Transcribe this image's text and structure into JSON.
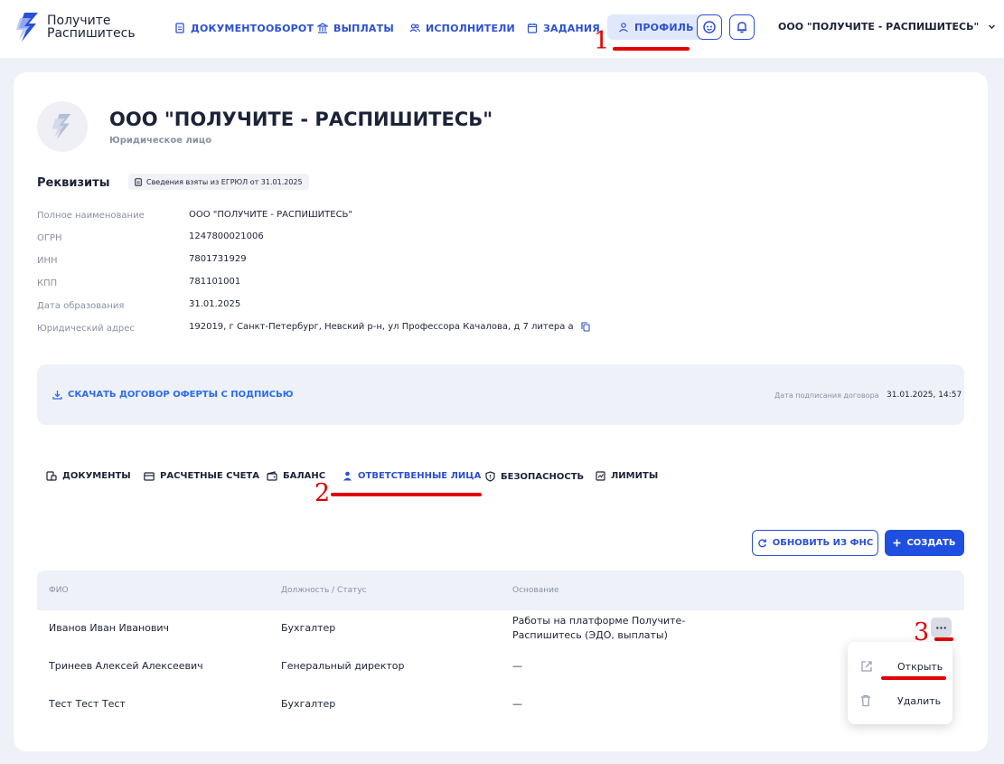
{
  "brand": {
    "line1": "Получите",
    "line2": "Распишитесь"
  },
  "nav": {
    "documents": "ДОКУМЕНТООБОРОТ",
    "payments": "ВЫПЛАТЫ",
    "executors": "ИСПОЛНИТЕЛИ",
    "tasks": "ЗАДАНИЯ",
    "profile": "ПРОФИЛЬ"
  },
  "org_selector": "ООО \"ПОЛУЧИТЕ - РАСПИШИТЕСЬ\"",
  "annotations": {
    "a1": "1",
    "a2": "2",
    "a3": "3"
  },
  "company": {
    "name": "ООО \"ПОЛУЧИТЕ - РАСПИШИТЕСЬ\"",
    "type": "Юридическое лицо"
  },
  "requisites": {
    "title": "Реквизиты",
    "badge": "Сведения взяты из ЕГРЮЛ от 31.01.2025",
    "fields": [
      {
        "label": "Полное наименование",
        "value": "ООО \"ПОЛУЧИТЕ - РАСПИШИТЕСЬ\""
      },
      {
        "label": "ОГРН",
        "value": "1247800021006"
      },
      {
        "label": "ИНН",
        "value": "7801731929"
      },
      {
        "label": "КПП",
        "value": "781101001"
      },
      {
        "label": "Дата образования",
        "value": "31.01.2025"
      },
      {
        "label": "Юридический адрес",
        "value": "192019, г Санкт-Петербург, Невский р-н, ул Профессора Качалова, д 7 литера а"
      }
    ]
  },
  "offer": {
    "download_label": "СКАЧАТЬ ДОГОВОР ОФЕРТЫ С ПОДПИСЬЮ",
    "date_label": "Дата подписания договора",
    "date_value": "31.01.2025, 14:57"
  },
  "tabs": {
    "documents": "ДОКУМЕНТЫ",
    "accounts": "РАСЧЕТНЫЕ СЧЕТА",
    "balance": "БАЛАНС",
    "responsible": "ОТВЕТСТВЕННЫЕ ЛИЦА",
    "security": "БЕЗОПАСНОСТЬ",
    "limits": "ЛИМИТЫ"
  },
  "actions": {
    "refresh": "ОБНОВИТЬ ИЗ ФНС",
    "create": "СОЗДАТЬ"
  },
  "table": {
    "headers": {
      "fio": "ФИО",
      "position": "Должность / Статус",
      "basis": "Основание"
    },
    "rows": [
      {
        "fio": "Иванов Иван Иванович",
        "position": "Бухгалтер",
        "basis_line1": "Работы на платформе Получите-",
        "basis_line2": "Распишитесь (ЭДО, выплаты)"
      },
      {
        "fio": "Тринеев Алексей Алексеевич",
        "position": "Генеральный директор",
        "basis_line1": "—"
      },
      {
        "fio": "Тест Тест Тест",
        "position": "Бухгалтер",
        "basis_line1": "—"
      }
    ],
    "more_label": "···"
  },
  "context_menu": {
    "open": "Открыть",
    "delete": "Удалить"
  },
  "colors": {
    "accent": "#2b4fd6",
    "primary": "#1f4fe0",
    "annotation": "#e20000",
    "background": "#eef1f7"
  }
}
